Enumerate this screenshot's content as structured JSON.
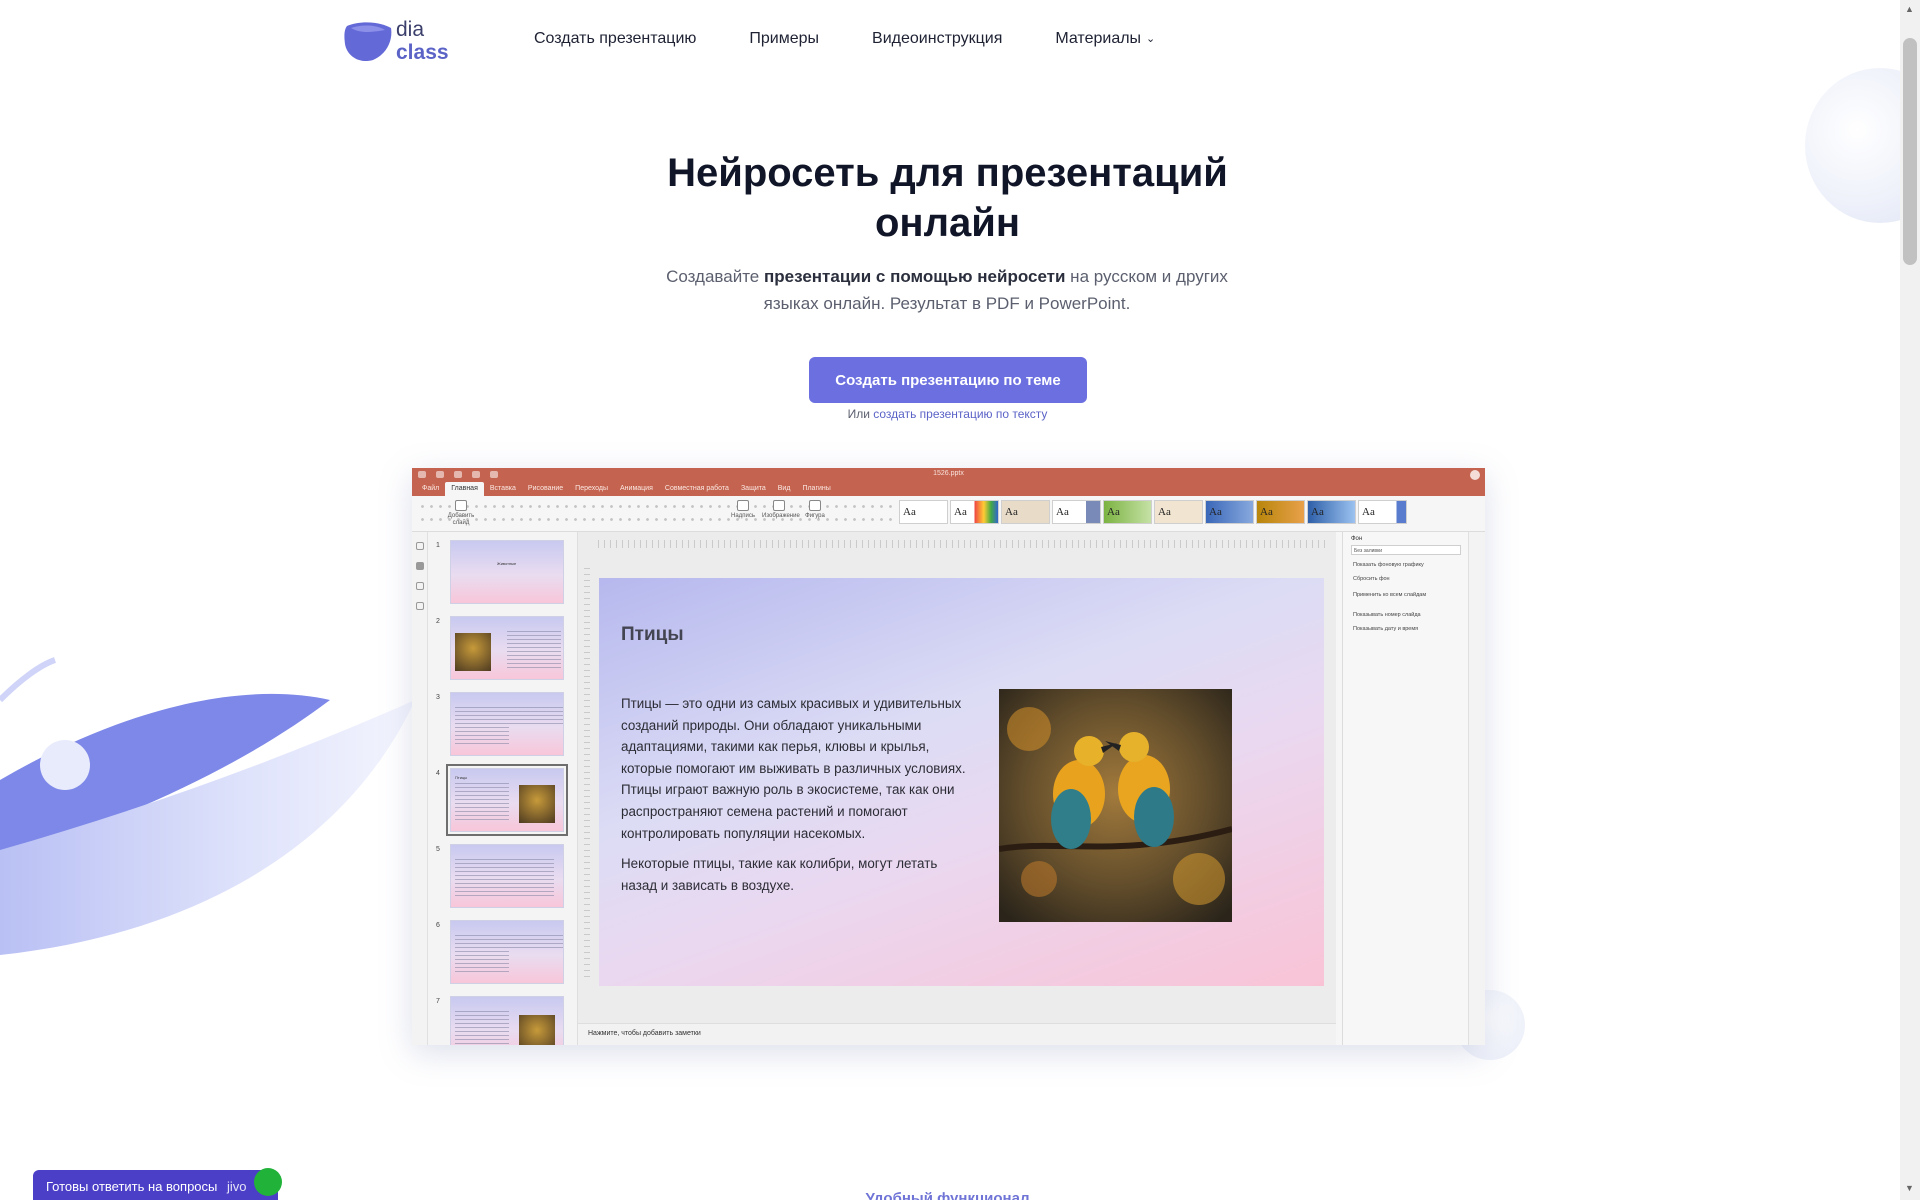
{
  "logo": {
    "line1": "dia",
    "line2": "class"
  },
  "nav": {
    "items": [
      "Создать презентацию",
      "Примеры",
      "Видеоинструкция"
    ],
    "materials": "Материалы"
  },
  "hero": {
    "title_line1": "Нейросеть для презентаций",
    "title_line2": "онлайн",
    "sub_pre": "Создавайте ",
    "sub_bold": "презентации с помощью нейросети",
    "sub_post": " на русском и других языках онлайн. Результат в PDF и PowerPoint.",
    "cta": "Создать презентацию по теме",
    "or_pre": "Или ",
    "or_link": "создать презентацию по тексту"
  },
  "app": {
    "file_name": "1526.pptx",
    "menu": [
      "Файл",
      "Главная",
      "Вставка",
      "Рисование",
      "Переходы",
      "Анимация",
      "Совместная работа",
      "Защита",
      "Вид",
      "Плагины"
    ],
    "active_menu": "Главная",
    "toolbar": {
      "add_slide": "Добавить слайд",
      "text": "Надпись",
      "image": "Изображение",
      "shape": "Фигура"
    },
    "theme_label": "Aa",
    "slide_numbers": [
      "1",
      "2",
      "3",
      "4",
      "5",
      "6",
      "7"
    ],
    "thumb_titles": [
      "Животные",
      "",
      "",
      "Птицы",
      "",
      "",
      ""
    ],
    "slide": {
      "title": "Птицы",
      "p1": "Птицы — это одни из самых красивых и удивительных созданий природы. Они обладают уникальными адаптациями, такими как перья, клювы и крылья, которые помогают им выживать в различных условиях. Птицы играют важную роль в экосистеме, так как они распространяют семена растений и помогают контролировать популяции насекомых.",
      "p2": "Некоторые птицы, такие как колибри, могут летать назад и зависать в воздухе."
    },
    "notes": "Нажмите, чтобы добавить заметки",
    "props": {
      "heading": "Фон",
      "fill": "Без заливки",
      "options": [
        "Показать фоновую графику",
        "Сбросить фон",
        "Применить ко всем слайдам",
        "Показывать номер слайда",
        "Показывать дату и время"
      ]
    }
  },
  "chat": {
    "label": "Готовы ответить на вопросы",
    "brand": "jivo"
  },
  "section_peek": "Удобный функционал"
}
